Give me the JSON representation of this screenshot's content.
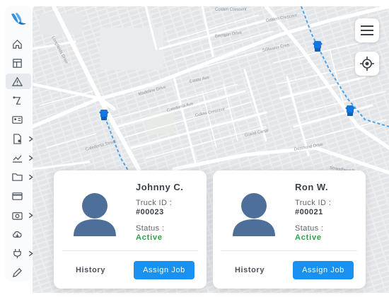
{
  "sidebar": {
    "logo": "bird-logo-icon",
    "items": [
      {
        "icon": "home-icon",
        "has_submenu": false
      },
      {
        "icon": "layout-icon",
        "has_submenu": false
      },
      {
        "icon": "alert-triangle-icon",
        "has_submenu": false,
        "active": true
      },
      {
        "icon": "route-icon",
        "has_submenu": false
      },
      {
        "icon": "id-card-icon",
        "has_submenu": false
      },
      {
        "icon": "document-settings-icon",
        "has_submenu": true
      },
      {
        "icon": "chart-line-icon",
        "has_submenu": true
      },
      {
        "icon": "folder-icon",
        "has_submenu": true
      },
      {
        "icon": "credit-card-icon",
        "has_submenu": false
      },
      {
        "icon": "camera-icon",
        "has_submenu": true
      },
      {
        "icon": "cloud-download-icon",
        "has_submenu": false
      },
      {
        "icon": "plug-icon",
        "has_submenu": true
      },
      {
        "icon": "edit-icon",
        "has_submenu": false
      }
    ]
  },
  "map": {
    "streets": {
      "colden_ave": "Colden Crescent",
      "berrigan_drive": "Berrigan Drive",
      "madeline_drive": "Madeline Drive",
      "estate_ave": "Estate Ave",
      "caledonia_ave": "Caledonia Ave",
      "cultas_cres": "Cultas Crescent",
      "stillwater_cres": "Stillwater Cres",
      "desmond_drive": "Desmond Drive",
      "strandherd_dr": "Strandherd Dr.",
      "longfields_drive": "Longfields Drive",
      "grand_canal": "Grand Canal",
      "caledonia_street": "Caledonia Street",
      "colden_cres": "Colden Crescent"
    },
    "menu_icon": "hamburger-menu-icon",
    "locate_icon": "crosshair-target-icon",
    "colors": {
      "route": "#4aa3e8",
      "truck": "#1477e0",
      "road": "#ffffff",
      "block": "#e2e5e8"
    }
  },
  "drivers": [
    {
      "name": "Johnny C.",
      "truck_label": "Truck ID :",
      "truck_id": "#00023",
      "status_label": "Status :",
      "status": "Active",
      "history_label": "History",
      "assign_label": "Assign Job"
    },
    {
      "name": "Ron W.",
      "truck_label": "Truck ID :",
      "truck_id": "#00021",
      "status_label": "Status :",
      "status": "Active",
      "history_label": "History",
      "assign_label": "Assign Job"
    }
  ],
  "colors": {
    "accent": "#1a90ef",
    "active_status": "#27a445",
    "avatar": "#4f6f9b"
  }
}
